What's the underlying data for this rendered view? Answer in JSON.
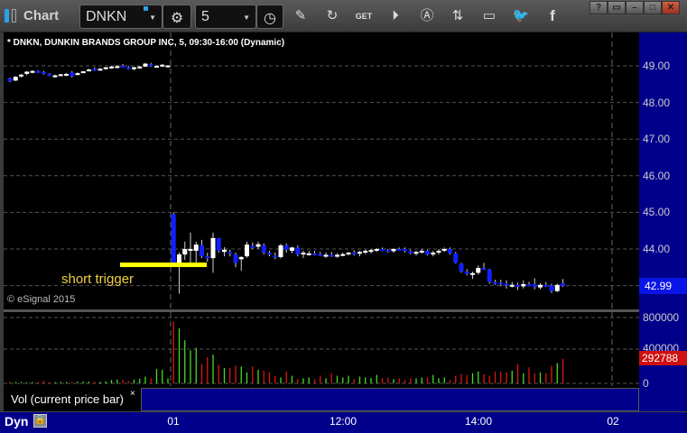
{
  "app": {
    "title": "Chart"
  },
  "toolbar": {
    "symbol": "DNKN",
    "interval": "5",
    "icons": [
      "gear-icon",
      "clock-icon",
      "pencil-icon",
      "refresh-icon",
      "get-icon",
      "play-icon",
      "alert-icon",
      "link-icon",
      "comment-icon",
      "twitter-icon",
      "facebook-icon"
    ]
  },
  "window": {
    "help": "?",
    "min": "–",
    "max": "□",
    "close": "✕"
  },
  "chart": {
    "header": "* DNKN, DUNKIN BRANDS GROUP INC, 5, 09:30-16:00 (Dynamic)",
    "copyright": "© eSignal 2015",
    "annotation": "short trigger",
    "last_price": "42.99",
    "trigger_price": 43.58,
    "price_labels": [
      "49.00",
      "48.00",
      "47.00",
      "46.00",
      "45.00",
      "44.00"
    ],
    "colors": {
      "up": "#ffffff",
      "down": "#1020ff",
      "vol_up": "#44dd22",
      "vol_down": "#dd1515",
      "trigger": "#ffff00"
    }
  },
  "volume": {
    "label": "Vol (current price bar)",
    "close": "×",
    "labels": [
      "800000",
      "400000",
      "0"
    ],
    "last": "292788"
  },
  "xaxis": {
    "mode": "Dyn",
    "ticks": [
      "01",
      "12:00",
      "14:00",
      "02"
    ]
  },
  "chart_data": {
    "type": "candlestick",
    "ylim": [
      42.4,
      49.9
    ],
    "vol_max": 800000,
    "bars": [
      [
        48.66,
        48.68,
        48.55,
        48.58,
        18000
      ],
      [
        48.6,
        48.72,
        48.58,
        48.7,
        15000
      ],
      [
        48.72,
        48.78,
        48.68,
        48.76,
        16000
      ],
      [
        48.78,
        48.86,
        48.74,
        48.84,
        14000
      ],
      [
        48.85,
        48.88,
        48.8,
        48.86,
        15000
      ],
      [
        48.86,
        48.88,
        48.8,
        48.82,
        16000
      ],
      [
        48.83,
        48.86,
        48.76,
        48.78,
        30000
      ],
      [
        48.78,
        48.8,
        48.72,
        48.74,
        14000
      ],
      [
        48.72,
        48.76,
        48.68,
        48.74,
        15000
      ],
      [
        48.75,
        48.78,
        48.72,
        48.77,
        16000
      ],
      [
        48.74,
        48.8,
        48.72,
        48.78,
        16000
      ],
      [
        48.82,
        48.86,
        48.68,
        48.72,
        17000
      ],
      [
        48.75,
        48.82,
        48.74,
        48.8,
        20000
      ],
      [
        48.82,
        48.86,
        48.8,
        48.85,
        22000
      ],
      [
        48.87,
        48.92,
        48.86,
        48.9,
        20000
      ],
      [
        48.92,
        48.96,
        48.86,
        48.88,
        20000
      ],
      [
        48.9,
        48.94,
        48.88,
        48.92,
        18000
      ],
      [
        48.92,
        48.97,
        48.9,
        48.96,
        25000
      ],
      [
        48.95,
        49.0,
        48.92,
        48.98,
        40000
      ],
      [
        48.97,
        49.02,
        48.94,
        48.99,
        45000
      ],
      [
        49.0,
        49.05,
        48.96,
        48.98,
        45000
      ],
      [
        48.96,
        49.0,
        48.9,
        48.92,
        30000
      ],
      [
        48.92,
        48.98,
        48.88,
        48.96,
        45000
      ],
      [
        48.96,
        49.0,
        48.92,
        48.98,
        55000
      ],
      [
        48.98,
        49.08,
        48.97,
        49.06,
        80000
      ],
      [
        49.04,
        49.08,
        48.97,
        48.99,
        60000
      ],
      [
        48.98,
        49.02,
        48.96,
        49.0,
        170000
      ],
      [
        49.0,
        49.05,
        48.97,
        49.03,
        160000
      ],
      [
        49.0,
        49.02,
        48.98,
        49.01,
        60000
      ],
      [
        44.95,
        45.0,
        43.6,
        43.62,
        730000
      ],
      [
        43.55,
        43.9,
        42.78,
        43.85,
        650000
      ],
      [
        43.85,
        44.2,
        43.7,
        44.0,
        510000
      ],
      [
        43.95,
        44.45,
        43.55,
        44.0,
        390000
      ],
      [
        43.95,
        44.2,
        43.6,
        44.12,
        420000
      ],
      [
        44.1,
        44.25,
        43.75,
        43.8,
        230000
      ],
      [
        43.8,
        43.9,
        43.65,
        43.75,
        310000
      ],
      [
        43.75,
        44.45,
        43.35,
        44.3,
        340000
      ],
      [
        44.3,
        44.3,
        43.9,
        43.95,
        220000
      ],
      [
        43.92,
        44.05,
        43.8,
        43.98,
        180000
      ],
      [
        43.92,
        43.98,
        43.8,
        43.88,
        185000
      ],
      [
        43.85,
        43.9,
        43.5,
        43.62,
        210000
      ],
      [
        43.72,
        43.8,
        43.4,
        43.78,
        200000
      ],
      [
        43.8,
        44.2,
        43.76,
        44.12,
        130000
      ],
      [
        44.08,
        44.18,
        44.0,
        44.06,
        200000
      ],
      [
        44.06,
        44.2,
        44.0,
        44.13,
        160000
      ],
      [
        44.1,
        44.15,
        43.85,
        43.9,
        150000
      ],
      [
        43.9,
        43.95,
        43.8,
        43.88,
        130000
      ],
      [
        43.82,
        43.9,
        43.72,
        43.78,
        90000
      ],
      [
        43.78,
        44.14,
        43.74,
        44.1,
        70000
      ],
      [
        44.1,
        44.15,
        43.9,
        43.98,
        140000
      ],
      [
        43.95,
        44.06,
        43.88,
        44.04,
        90000
      ],
      [
        44.04,
        44.1,
        43.8,
        43.85,
        50000
      ],
      [
        43.85,
        43.95,
        43.75,
        43.9,
        60000
      ],
      [
        43.85,
        43.95,
        43.82,
        43.88,
        70000
      ],
      [
        43.88,
        43.95,
        43.82,
        43.86,
        50000
      ],
      [
        43.86,
        43.92,
        43.8,
        43.85,
        90000
      ],
      [
        43.82,
        43.9,
        43.76,
        43.84,
        60000
      ],
      [
        43.84,
        43.92,
        43.78,
        43.8,
        120000
      ],
      [
        43.82,
        43.88,
        43.76,
        43.84,
        90000
      ],
      [
        43.84,
        43.9,
        43.8,
        43.86,
        70000
      ],
      [
        43.86,
        43.92,
        43.82,
        43.9,
        90000
      ],
      [
        43.9,
        43.96,
        43.82,
        43.88,
        50000
      ],
      [
        43.88,
        43.95,
        43.8,
        43.92,
        80000
      ],
      [
        43.92,
        43.98,
        43.86,
        43.95,
        70000
      ],
      [
        43.95,
        44.0,
        43.88,
        43.97,
        65000
      ],
      [
        43.96,
        44.02,
        43.92,
        44.0,
        100000
      ],
      [
        44.0,
        44.04,
        43.94,
        43.97,
        60000
      ],
      [
        43.97,
        44.0,
        43.9,
        43.94,
        65000
      ],
      [
        43.94,
        44.02,
        43.9,
        44.0,
        50000
      ],
      [
        44.0,
        44.04,
        43.96,
        43.99,
        60000
      ],
      [
        44.0,
        44.04,
        43.9,
        43.94,
        40000
      ],
      [
        43.94,
        43.98,
        43.85,
        43.88,
        60000
      ],
      [
        43.88,
        43.95,
        43.82,
        43.92,
        60000
      ],
      [
        43.92,
        44.0,
        43.88,
        43.95,
        70000
      ],
      [
        43.95,
        43.98,
        43.82,
        43.85,
        70000
      ],
      [
        43.85,
        43.95,
        43.8,
        43.9,
        100000
      ],
      [
        43.9,
        44.0,
        43.85,
        43.95,
        60000
      ],
      [
        43.95,
        44.04,
        43.92,
        44.0,
        70000
      ],
      [
        44.0,
        44.04,
        43.85,
        43.88,
        40000
      ],
      [
        43.88,
        43.92,
        43.6,
        43.62,
        90000
      ],
      [
        43.6,
        43.62,
        43.35,
        43.38,
        110000
      ],
      [
        43.38,
        43.45,
        43.28,
        43.32,
        100000
      ],
      [
        43.3,
        43.38,
        43.18,
        43.34,
        120000
      ],
      [
        43.35,
        43.55,
        43.3,
        43.48,
        140000
      ],
      [
        43.48,
        43.62,
        43.42,
        43.44,
        110000
      ],
      [
        43.44,
        43.46,
        43.05,
        43.1,
        90000
      ],
      [
        43.1,
        43.16,
        43.02,
        43.08,
        140000
      ],
      [
        43.08,
        43.16,
        42.98,
        43.05,
        140000
      ],
      [
        43.05,
        43.15,
        42.92,
        43.0,
        130000
      ],
      [
        43.0,
        43.1,
        42.95,
        43.02,
        150000
      ],
      [
        43.02,
        43.08,
        42.88,
        42.98,
        230000
      ],
      [
        42.98,
        43.14,
        42.92,
        43.04,
        120000
      ],
      [
        43.04,
        43.1,
        42.98,
        43.02,
        190000
      ],
      [
        43.04,
        43.2,
        42.9,
        42.96,
        120000
      ],
      [
        42.95,
        43.06,
        42.9,
        43.02,
        130000
      ],
      [
        43.02,
        43.1,
        42.96,
        42.98,
        120000
      ],
      [
        43.0,
        43.05,
        42.8,
        42.85,
        210000
      ],
      [
        42.85,
        43.05,
        42.82,
        43.02,
        240000
      ],
      [
        43.06,
        43.18,
        42.96,
        42.99,
        292788
      ]
    ]
  }
}
